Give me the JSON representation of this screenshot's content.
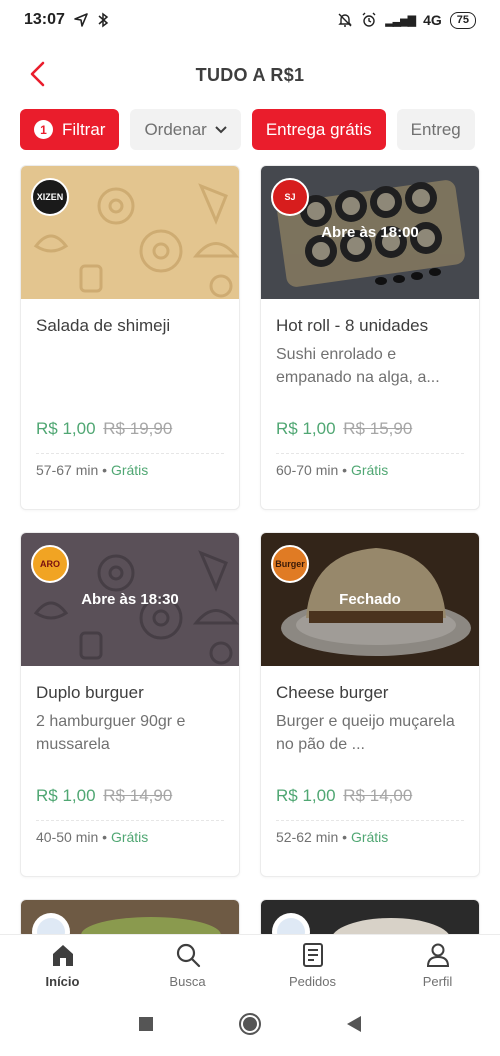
{
  "status": {
    "time": "13:07",
    "network": "4G",
    "battery": "75"
  },
  "header": {
    "title": "TUDO A R$1",
    "back_icon": "chevron-left-icon"
  },
  "colors": {
    "brand_red": "#ea1d2c",
    "price_green": "#50a773",
    "text": "#3e3e3e",
    "muted": "#717171",
    "chip_grey": "#f2f2f2"
  },
  "filters": {
    "filter_count": "1",
    "filter_label": "Filtrar",
    "order_label": "Ordenar",
    "free_delivery_label": "Entrega grátis",
    "partial_label": "Entreg"
  },
  "cards": [
    {
      "name": "Salada de shimeji",
      "description": "",
      "overlay": "",
      "price": "R$ 1,00",
      "old_price": "R$ 19,90",
      "time": "57-67 min",
      "delivery": "Grátis",
      "logo_text": "XIZEN"
    },
    {
      "name": "Hot roll - 8 unidades",
      "description": "Sushi enrolado e empanado na alga, a...",
      "overlay": "Abre às 18:00",
      "price": "R$ 1,00",
      "old_price": "R$ 15,90",
      "time": "60-70 min",
      "delivery": "Grátis",
      "logo_text": "SJ"
    },
    {
      "name": "Duplo burguer",
      "description": "2 hamburguer 90gr e mussarela",
      "overlay": "Abre às 18:30",
      "price": "R$ 1,00",
      "old_price": "R$ 14,90",
      "time": "40-50 min",
      "delivery": "Grátis",
      "logo_text": "ARO"
    },
    {
      "name": "Cheese burger",
      "description": "Burger e queijo muçarela no pão de ...",
      "overlay": "Fechado",
      "price": "R$ 1,00",
      "old_price": "R$ 14,00",
      "time": "52-62 min",
      "delivery": "Grátis",
      "logo_text": "Burger"
    }
  ],
  "separator": "•",
  "bottom_nav": {
    "home": "Início",
    "search": "Busca",
    "orders": "Pedidos",
    "profile": "Perfil"
  }
}
